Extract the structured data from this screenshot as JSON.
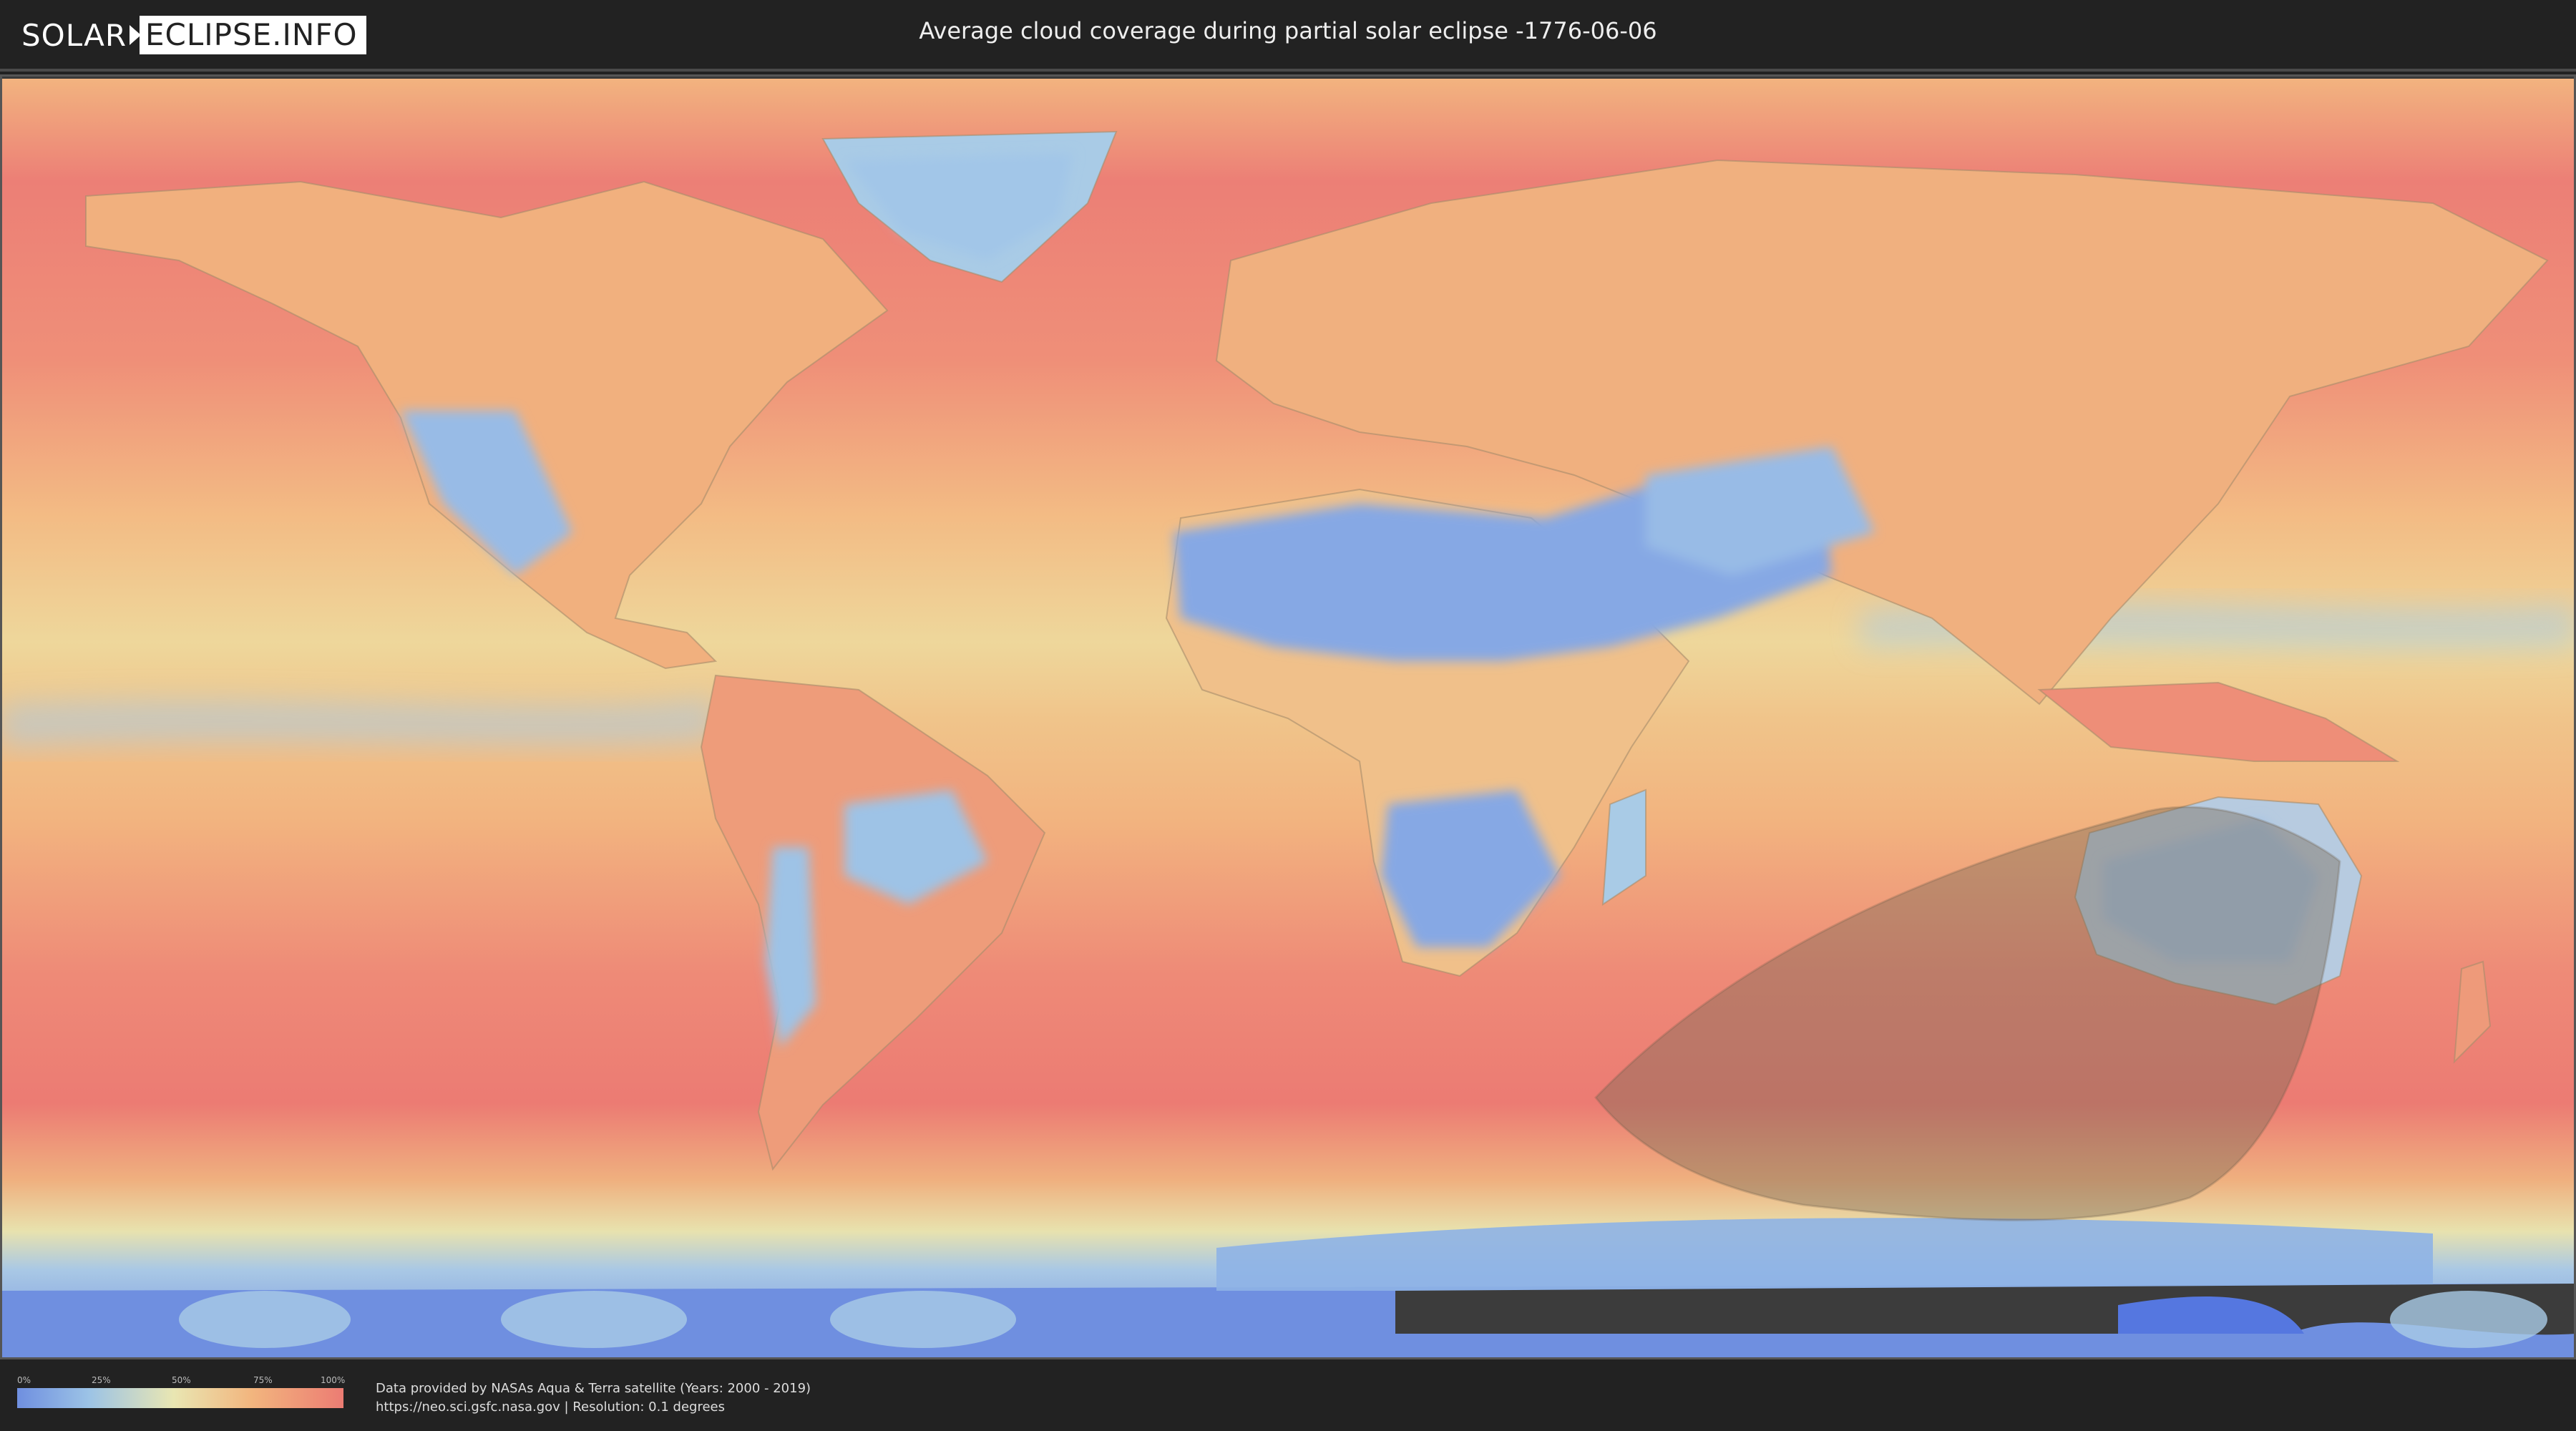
{
  "header": {
    "logo_left": "SOLAR",
    "logo_right": "ECLIPSE.INFO",
    "title": "Average cloud coverage during partial solar eclipse -1776-06-06"
  },
  "map": {
    "colors": {
      "ocean_cloudy": "#ec7f76",
      "ocean_mid": "#f3b07f",
      "clear_sky": "#7c9ee6",
      "partly_clear": "#a9cbe6",
      "neutral": "#ece6b2",
      "eclipse_shade": "#8c7a5e",
      "antarctic_dark": "#3c3c3c"
    }
  },
  "legend": {
    "ticks": [
      "0%",
      "25%",
      "50%",
      "75%",
      "100%"
    ],
    "tick_values": [
      0,
      25,
      50,
      75,
      100
    ]
  },
  "credits": {
    "line1": "Data provided by NASAs Aqua & Terra satellite (Years: 2000 - 2019)",
    "line2": "https://neo.sci.gsfc.nasa.gov | Resolution: 0.1 degrees"
  }
}
